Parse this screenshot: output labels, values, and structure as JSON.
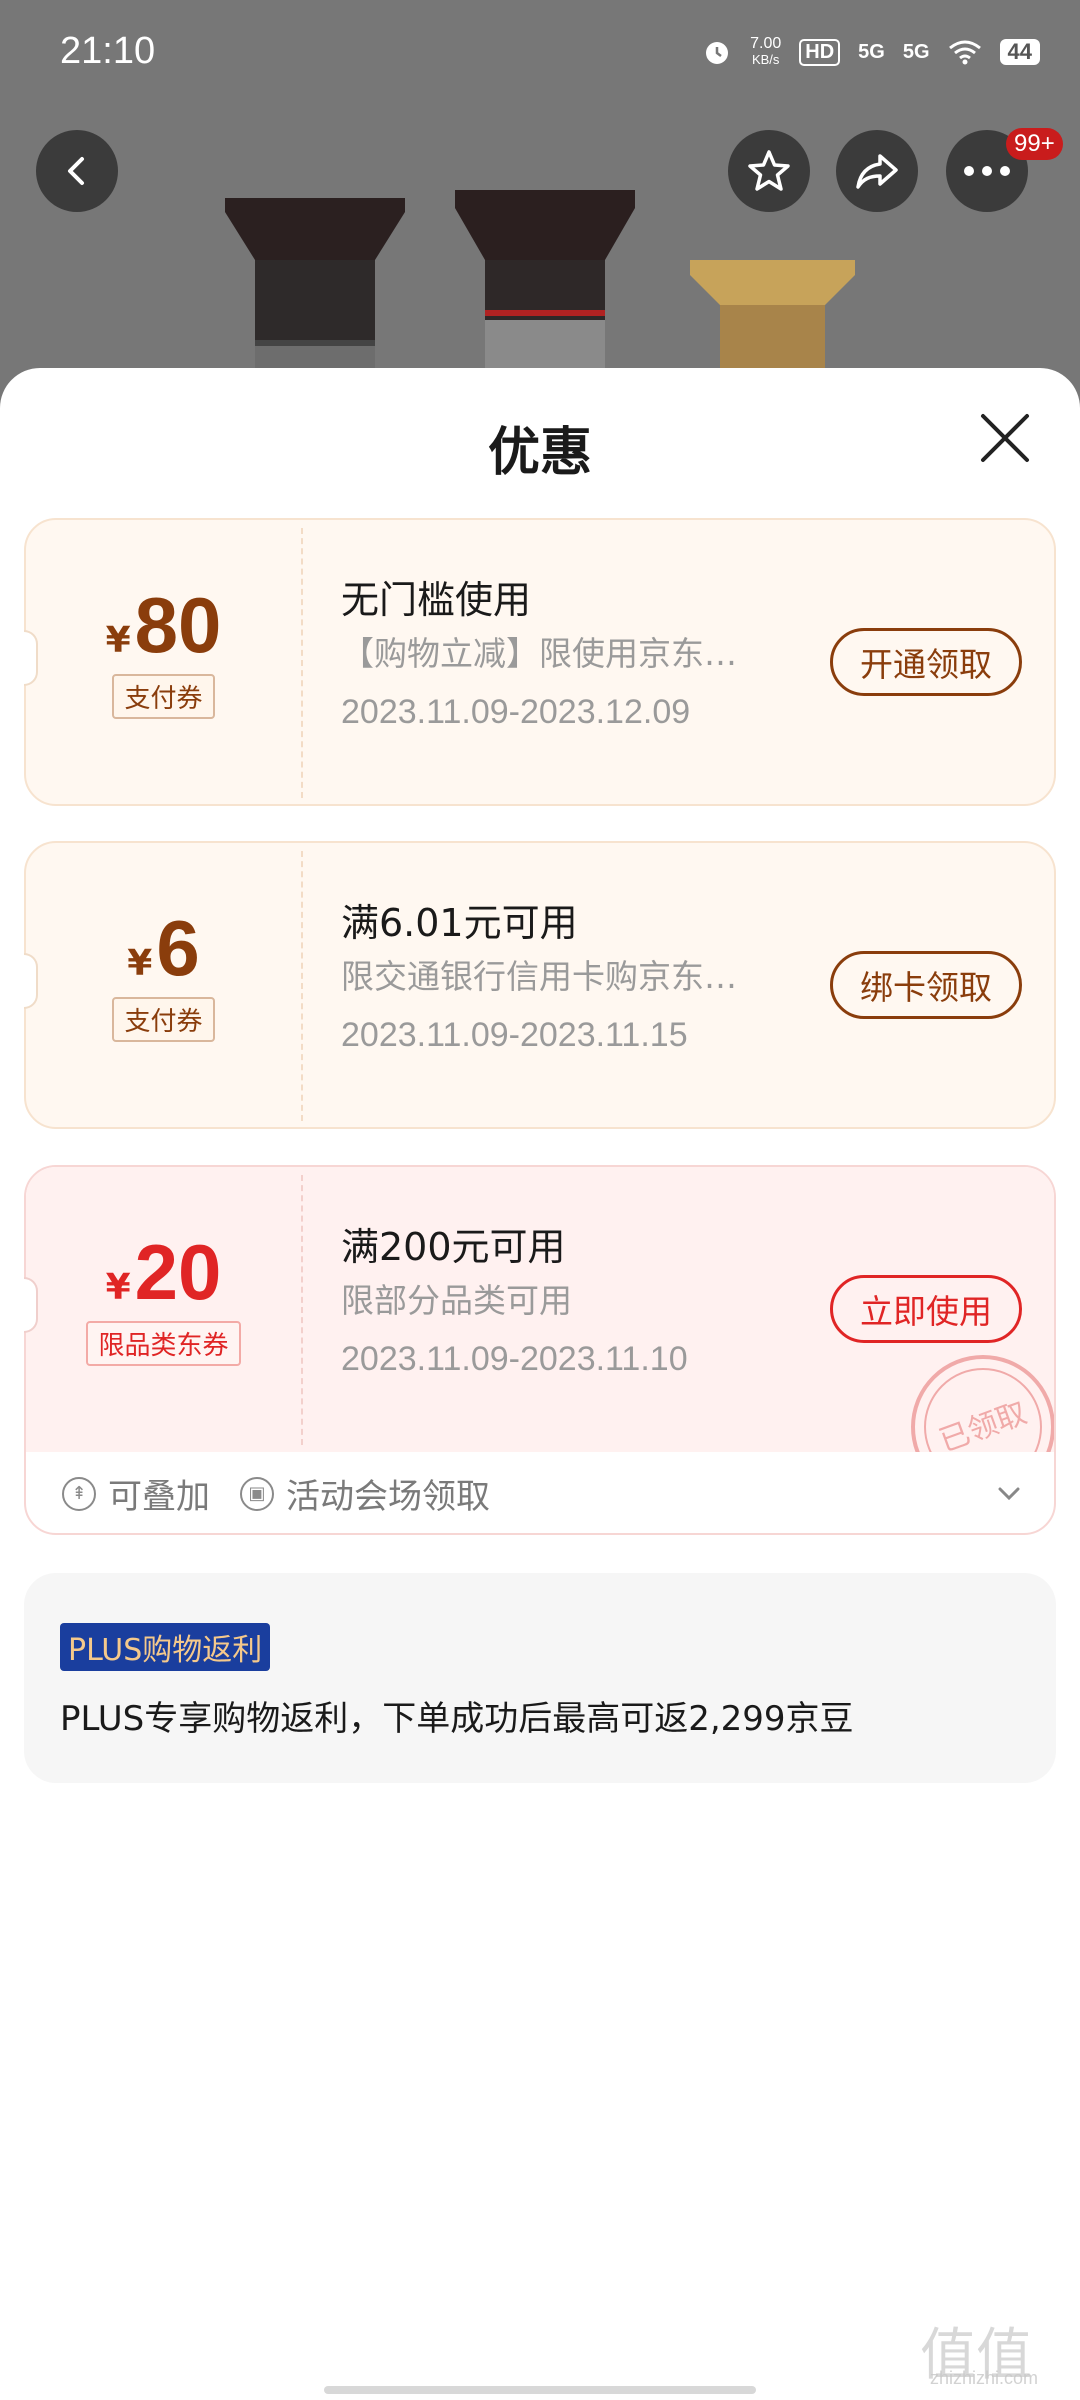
{
  "status_bar": {
    "time": "21:10",
    "net_speed_value": "7.00",
    "net_speed_unit": "KB/s",
    "hd": "HD",
    "sim1": "5G",
    "sim2": "5G",
    "battery": "44"
  },
  "header": {
    "more_badge": "99+",
    "icons": [
      "back-arrow-icon",
      "star-icon",
      "share-icon",
      "more-icon"
    ]
  },
  "sheet": {
    "title": "优惠"
  },
  "coupons": [
    {
      "currency": "¥",
      "amount": "80",
      "type_tag": "支付券",
      "title": "无门槛使用",
      "desc": "【购物立减】限使用京东…",
      "date": "2023.11.09-2023.12.09",
      "action": "开通领取"
    },
    {
      "currency": "¥",
      "amount": "6",
      "type_tag": "支付券",
      "title": "满6.01元可用",
      "desc": "限交通银行信用卡购京东…",
      "date": "2023.11.09-2023.11.15",
      "action": "绑卡领取"
    },
    {
      "currency": "¥",
      "amount": "20",
      "type_tag": "限品类东券",
      "title": "满200元可用",
      "desc": "限部分品类可用",
      "date": "2023.11.09-2023.11.10",
      "action": "立即使用",
      "stamp_text": "已领取",
      "features": [
        "可叠加",
        "活动会场领取"
      ]
    }
  ],
  "plus": {
    "tag": "PLUS购物返利",
    "text": "PLUS专享购物返利，下单成功后最高可返2,299京豆"
  },
  "watermark": {
    "logo": "值值值",
    "site": "zhizhizhi.com"
  },
  "colors": {
    "brown": "#8a3d0c",
    "red": "#e02525",
    "plus_blue": "#1a3e9e",
    "plus_gold": "#f5c98b"
  }
}
